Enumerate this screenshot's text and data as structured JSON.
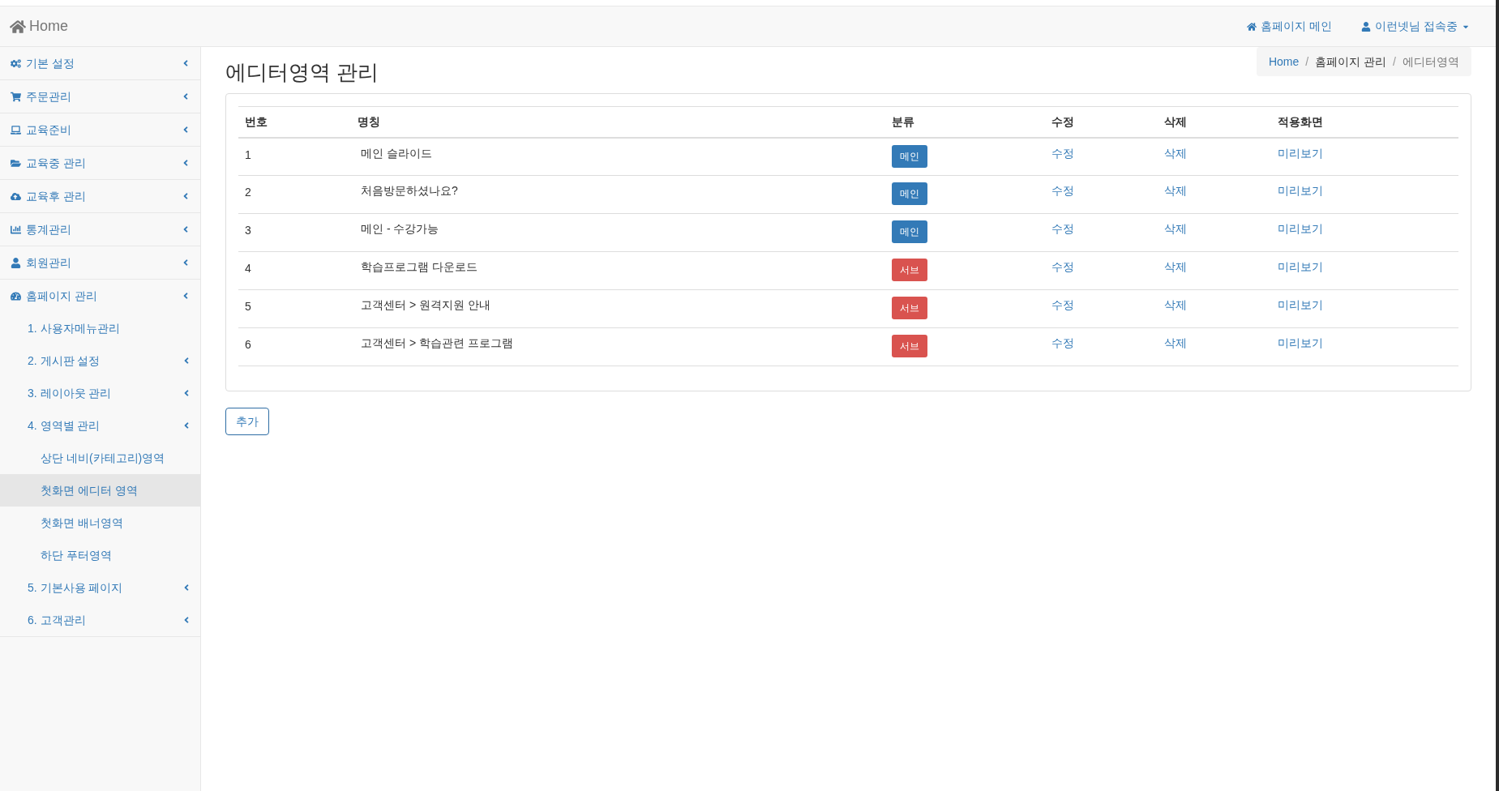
{
  "navbar": {
    "brand": "Home",
    "links": [
      {
        "kind": "home",
        "label": "홈페이지 메인"
      },
      {
        "kind": "user",
        "label": "이런넷님 접속중"
      }
    ]
  },
  "sidebar": {
    "items": [
      {
        "label": "기본 설정",
        "submenu": true
      },
      {
        "label": "주문관리",
        "submenu": true
      },
      {
        "label": "교육준비",
        "submenu": true
      },
      {
        "label": "교육중 관리",
        "submenu": true
      },
      {
        "label": "교육후 관리",
        "submenu": true
      },
      {
        "label": "통계관리",
        "submenu": true
      },
      {
        "label": "회원관리",
        "submenu": true
      },
      {
        "label": "홈페이지 관리",
        "submenu": true,
        "children": [
          {
            "label": "1. 사용자메뉴관리",
            "submenu": false,
            "selected": false
          },
          {
            "label": "2. 게시판 설정",
            "submenu": true,
            "selected": false
          },
          {
            "label": "3. 레이아웃 관리",
            "submenu": true,
            "selected": false
          },
          {
            "label": "4. 영역별 관리",
            "submenu": true,
            "selected": false,
            "children": [
              {
                "label": "상단 네비(카테고리)영역",
                "submenu": false,
                "selected": false
              },
              {
                "label": "첫화면 에디터 영역",
                "submenu": false,
                "selected": true
              },
              {
                "label": "첫화면 배너영역",
                "submenu": false,
                "selected": false
              },
              {
                "label": "하단 푸터영역",
                "submenu": false,
                "selected": false
              }
            ]
          },
          {
            "label": "5. 기본사용 페이지",
            "submenu": true,
            "selected": false
          },
          {
            "label": "6. 고객관리",
            "submenu": true,
            "selected": false
          }
        ]
      }
    ]
  },
  "page": {
    "title": "에디터영역 관리",
    "breadcrumb": [
      "Home",
      "홈페이지 관리",
      "에디터영역"
    ],
    "breadcrumb_separator": "/"
  },
  "table": {
    "columns": [
      "번호",
      "명칭",
      "분류",
      "수정",
      "삭제",
      "적용화면"
    ],
    "rows": [
      {
        "no": "1",
        "name": "메인 슬라이드",
        "category": {
          "label": "메인",
          "kind": "main"
        },
        "edit": "수정",
        "delete": "삭제",
        "preview": "미리보기"
      },
      {
        "no": "2",
        "name": "처음방문하셨나요?",
        "category": {
          "label": "메인",
          "kind": "main"
        },
        "edit": "수정",
        "delete": "삭제",
        "preview": "미리보기"
      },
      {
        "no": "3",
        "name": "메인 - 수강가능",
        "category": {
          "label": "메인",
          "kind": "main"
        },
        "edit": "수정",
        "delete": "삭제",
        "preview": "미리보기"
      },
      {
        "no": "4",
        "name": "학습프로그램 다운로드",
        "category": {
          "label": "서브",
          "kind": "sub"
        },
        "edit": "수정",
        "delete": "삭제",
        "preview": "미리보기"
      },
      {
        "no": "5",
        "name": "고객센터 > 원격지원 안내",
        "category": {
          "label": "서브",
          "kind": "sub"
        },
        "edit": "수정",
        "delete": "삭제",
        "preview": "미리보기"
      },
      {
        "no": "6",
        "name": "고객센터 > 학습관련 프로그램",
        "category": {
          "label": "서브",
          "kind": "sub"
        },
        "edit": "수정",
        "delete": "삭제",
        "preview": "미리보기"
      }
    ]
  },
  "add_button": "추가"
}
